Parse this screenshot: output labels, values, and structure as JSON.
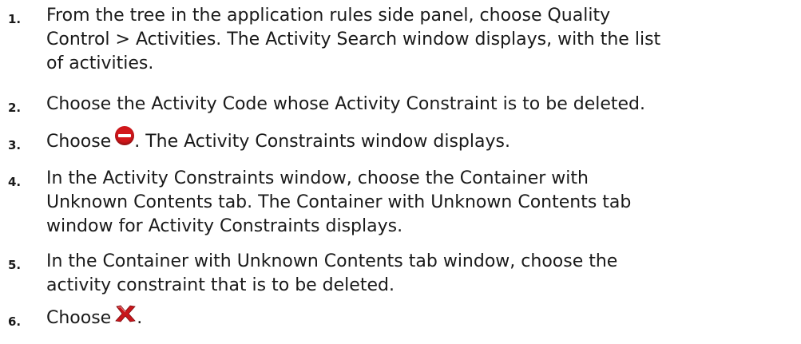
{
  "steps": [
    {
      "number": "1.",
      "lines": [
        "From the tree in the application rules side panel, choose Quality",
        "Control > Activities. The Activity Search window displays, with the list",
        "of activities."
      ]
    },
    {
      "number": "2.",
      "lines": [
        "Choose the Activity Code whose Activity Constraint is to be deleted."
      ]
    },
    {
      "number": "3.",
      "before": "Choose",
      "icon": "delete-constraint-icon",
      "after": ". The Activity Constraints window displays."
    },
    {
      "number": "4.",
      "lines": [
        "In the Activity Constraints window, choose the Container with",
        "Unknown Contents tab. The Container with Unknown Contents tab",
        "window for Activity Constraints displays."
      ]
    },
    {
      "number": "5.",
      "lines": [
        "In the Container with Unknown Contents tab window, choose the",
        "activity constraint that is to be deleted."
      ]
    },
    {
      "number": "6.",
      "before": "Choose",
      "icon": "red-x-delete-icon",
      "after": "."
    }
  ],
  "colors": {
    "text": "#1a1a1a",
    "delete_icon": "#d2171b",
    "x_icon": "#c8161b"
  }
}
